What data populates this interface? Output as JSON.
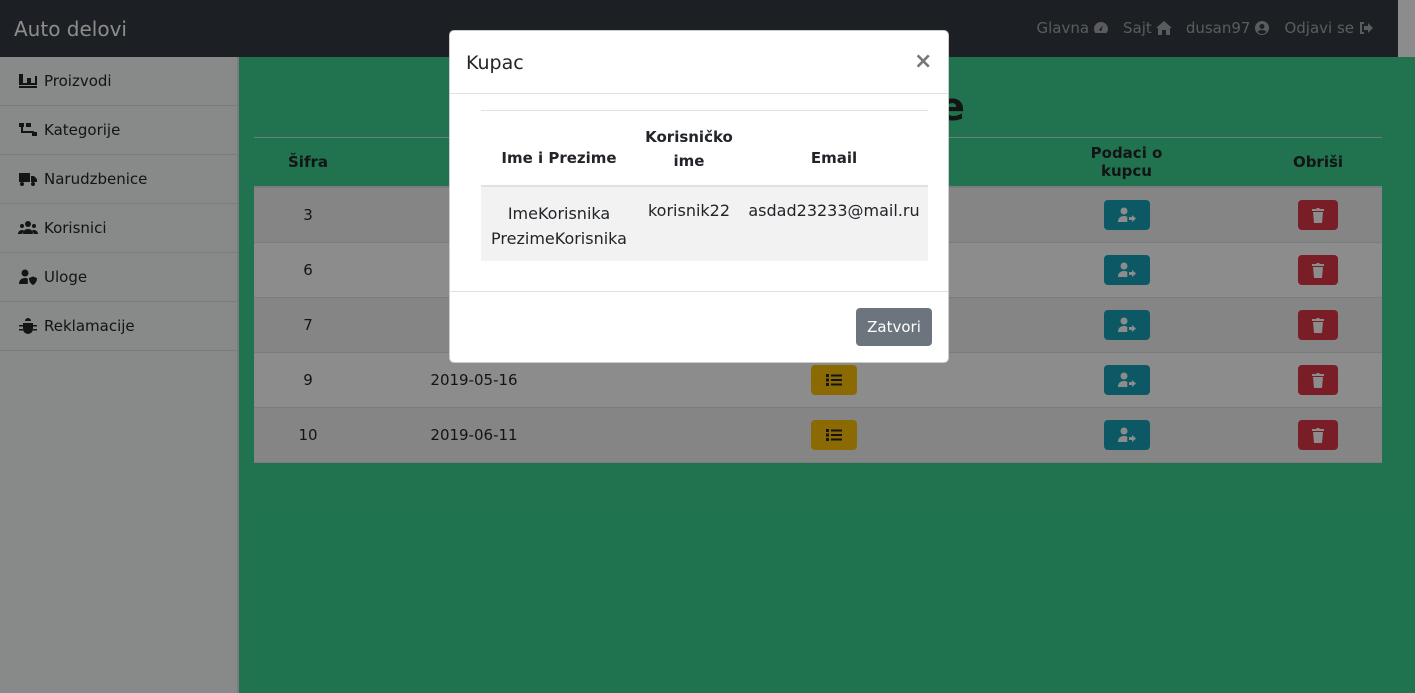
{
  "navbar": {
    "brand": "Auto delovi",
    "links": [
      {
        "label": "Glavna",
        "icon": "dashboard-icon"
      },
      {
        "label": "Sajt",
        "icon": "home-icon"
      },
      {
        "label": "dusan97",
        "icon": "user-circle-icon"
      },
      {
        "label": "Odjavi se",
        "icon": "sign-out-icon"
      }
    ]
  },
  "sidebar": {
    "items": [
      {
        "label": "Proizvodi",
        "icon": "pallet-icon"
      },
      {
        "label": "Kategorije",
        "icon": "sitemap-icon"
      },
      {
        "label": "Narudzbenice",
        "icon": "truck-icon"
      },
      {
        "label": "Korisnici",
        "icon": "users-icon"
      },
      {
        "label": "Uloge",
        "icon": "user-shield-icon"
      },
      {
        "label": "Reklamacije",
        "icon": "bug-icon"
      }
    ]
  },
  "main": {
    "title": "Narudzbenice",
    "headers": {
      "id": "Šifra",
      "date": "D",
      "items": "",
      "customer": "Podaci o kupcu",
      "delete": "Obriši"
    },
    "rows": [
      {
        "id": "3",
        "date": ""
      },
      {
        "id": "6",
        "date": ""
      },
      {
        "id": "7",
        "date": ""
      },
      {
        "id": "9",
        "date": "2019-05-16"
      },
      {
        "id": "10",
        "date": "2019-06-11"
      }
    ]
  },
  "modal": {
    "title": "Kupac",
    "close_symbol": "×",
    "headers": {
      "name": "Ime i Prezime",
      "username_line1": "Korisničko",
      "username_line2": "ime",
      "email": "Email"
    },
    "row": {
      "first_name": "ImeKorisnika",
      "last_name": "PrezimeKorisnika",
      "username": "korisnik22",
      "email": "asdad23233@mail.ru"
    },
    "close_button": "Zatvori"
  },
  "colors": {
    "navbar_bg": "#343a40",
    "main_bg": "#3bd28f",
    "warning": "#ffc107",
    "info": "#17a2b8",
    "danger": "#dc3545",
    "secondary": "#6c757d"
  }
}
